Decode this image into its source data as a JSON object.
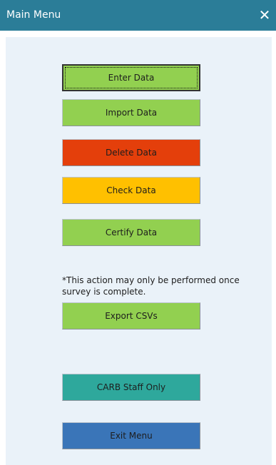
{
  "window": {
    "title": "Main Menu",
    "close_glyph": "✕",
    "titlebar_color": "#2b7d98",
    "body_color": "#eaf2f9"
  },
  "menu": {
    "enter_data": {
      "label": "Enter Data",
      "color": "#92d050"
    },
    "import_data": {
      "label": "Import Data",
      "color": "#92d050"
    },
    "delete_data": {
      "label": "Delete Data",
      "color": "#e43f0b"
    },
    "check_data": {
      "label": "Check Data",
      "color": "#ffc000"
    },
    "certify_data": {
      "label": "Certify Data",
      "color": "#92d050"
    },
    "note": "*This action may only be performed once survey is complete.",
    "export_csvs": {
      "label": "Export CSVs",
      "color": "#92d050"
    },
    "carb_staff_only": {
      "label": "CARB Staff Only",
      "color": "#2ea89c"
    },
    "exit_menu": {
      "label": "Exit Menu",
      "color": "#3a75b8"
    }
  }
}
